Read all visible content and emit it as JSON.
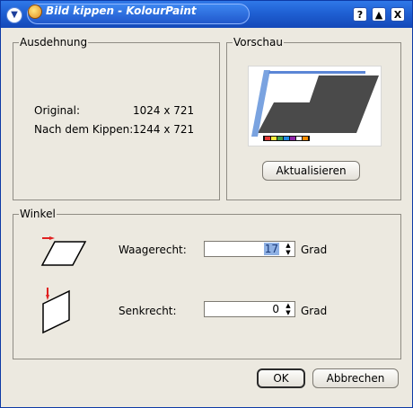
{
  "window": {
    "title": "Bild kippen - KolourPaint",
    "buttons": {
      "help": "?",
      "shade": "▲",
      "close": "X",
      "menu": "▼"
    }
  },
  "ausdehnung": {
    "title": "Ausdehnung",
    "original_label": "Original:",
    "original_value": "1024 x 721",
    "after_label": "Nach dem Kippen:",
    "after_value": "1244 x 721"
  },
  "vorschau": {
    "title": "Vorschau",
    "refresh_label": "Aktualisieren"
  },
  "winkel": {
    "title": "Winkel",
    "horizontal_label": "Waagerecht:",
    "horizontal_value": "17",
    "horizontal_unit": "Grad",
    "vertical_label": "Senkrecht:",
    "vertical_value": "0",
    "vertical_unit": "Grad"
  },
  "footer": {
    "ok_label": "OK",
    "cancel_label": "Abbrechen"
  },
  "colors": {
    "title_blue": "#1f60d3",
    "dialog_bg": "#ece9e0",
    "accent_red": "#e02020"
  },
  "icons": {
    "horizontal": "horizontal-skew-icon",
    "vertical": "vertical-skew-icon"
  }
}
